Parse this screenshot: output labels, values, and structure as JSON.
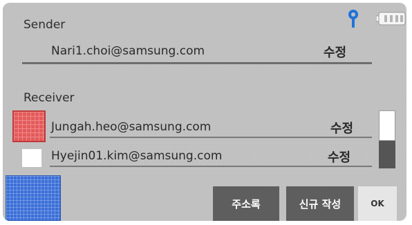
{
  "sender": {
    "label": "Sender",
    "email": "Nari1.choi@samsung.com",
    "edit_label": "수정"
  },
  "receiver": {
    "label": "Receiver",
    "items": [
      {
        "email": "Jungah.heo@samsung.com",
        "edit_label": "수정",
        "selected": true
      },
      {
        "email": "Hyejin01.kim@samsung.com",
        "edit_label": "수정",
        "selected": false
      }
    ]
  },
  "buttons": {
    "address_book": "주소록",
    "compose_new": "신규 작성",
    "ok": "OK"
  },
  "status": {
    "signal_icon": "antenna-icon",
    "battery_icon": "battery-icon"
  },
  "colors": {
    "background": "#c2c2c2",
    "selected_check": "#e45a5a",
    "blue_button": "#3b6fd8",
    "dark_button": "#5e5e5e"
  }
}
